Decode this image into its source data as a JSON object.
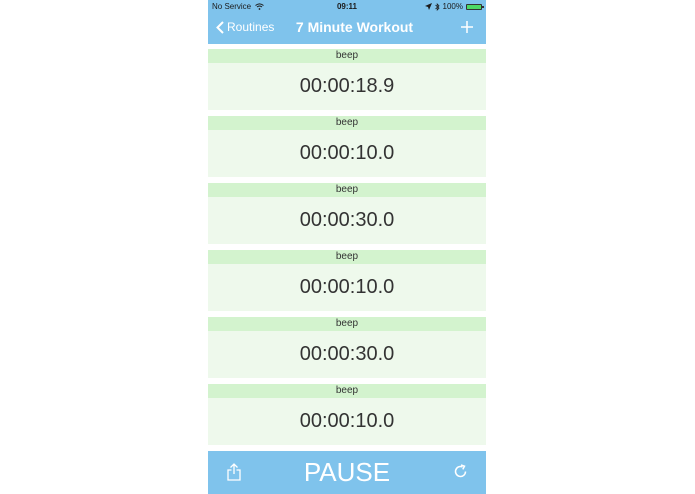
{
  "status_bar": {
    "carrier": "No Service",
    "time": "09:11",
    "battery": "100%",
    "battery_level": 1.0
  },
  "navbar": {
    "back_label": "Routines",
    "title": "7 Minute Workout",
    "add_icon": "plus-icon"
  },
  "steps": [
    {
      "label": "beep",
      "time": "00:00:18.9"
    },
    {
      "label": "beep",
      "time": "00:00:10.0"
    },
    {
      "label": "beep",
      "time": "00:00:30.0"
    },
    {
      "label": "beep",
      "time": "00:00:10.0"
    },
    {
      "label": "beep",
      "time": "00:00:30.0"
    },
    {
      "label": "beep",
      "time": "00:00:10.0"
    }
  ],
  "toolbar": {
    "pause_label": "PAUSE",
    "share_icon": "share-icon",
    "refresh_icon": "refresh-icon"
  },
  "colors": {
    "accent": "#7fc3ec",
    "row_label_bg": "#d3f3ce",
    "row_bg": "#eef9ec"
  }
}
